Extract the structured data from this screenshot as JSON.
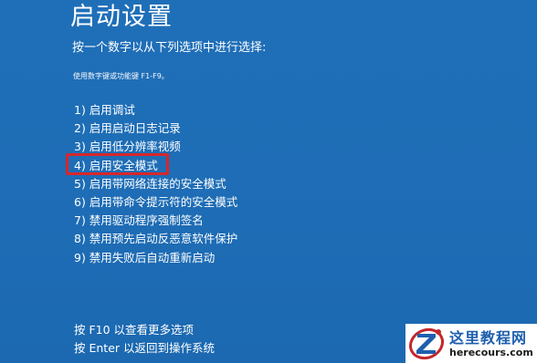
{
  "screen": {
    "title": "启动设置",
    "prompt": "按一个数字以从下列选项中进行选择:",
    "hint": "使用数字键或功能键 F1-F9。",
    "options": [
      "1) 启用调试",
      "2) 启用启动日志记录",
      "3) 启用低分辨率视频",
      "4) 启用安全模式",
      "5) 启用带网络连接的安全模式",
      "6) 启用带命令提示符的安全模式",
      "7) 禁用驱动程序强制签名",
      "8) 禁用预先启动反恶意软件保护",
      "9) 禁用失败后自动重新启动"
    ],
    "highlighted_option": "4) 启用安全模式",
    "footer": {
      "more_options": "按 F10 以查看更多选项",
      "return": "按 Enter 以返回到操作系统"
    }
  },
  "watermark": {
    "name": "这里教程网",
    "url": "herecours.com"
  },
  "colors": {
    "background": "#1f6fb8",
    "text": "#ffffff",
    "highlight": "#d7262b",
    "watermark_text": "#1f5fae"
  }
}
